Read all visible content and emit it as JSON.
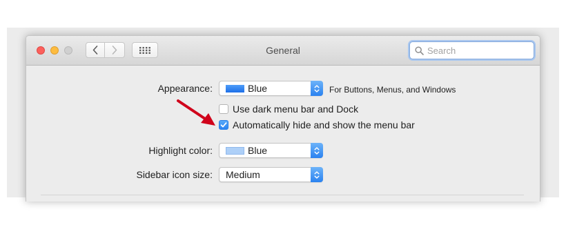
{
  "window": {
    "title": "General"
  },
  "toolbar": {
    "back_icon": "chevron-left-icon",
    "forward_icon": "chevron-right-icon",
    "show_all_icon": "grid-icon"
  },
  "search": {
    "placeholder": "Search",
    "value": ""
  },
  "appearance": {
    "label": "Appearance:",
    "value": "Blue",
    "swatch_color": "#2176ef",
    "note": "For Buttons, Menus, and Windows"
  },
  "options": {
    "dark_menu_bar": {
      "label": "Use dark menu bar and Dock",
      "checked": false
    },
    "auto_hide_menu_bar": {
      "label": "Automatically hide and show the menu bar",
      "checked": true
    }
  },
  "highlight": {
    "label": "Highlight color:",
    "value": "Blue",
    "swatch_color": "#aed0f8"
  },
  "sidebar_icon_size": {
    "label": "Sidebar icon size:",
    "value": "Medium"
  },
  "colors": {
    "accent": "#2a82f0",
    "annotation_arrow": "#d0021b"
  }
}
